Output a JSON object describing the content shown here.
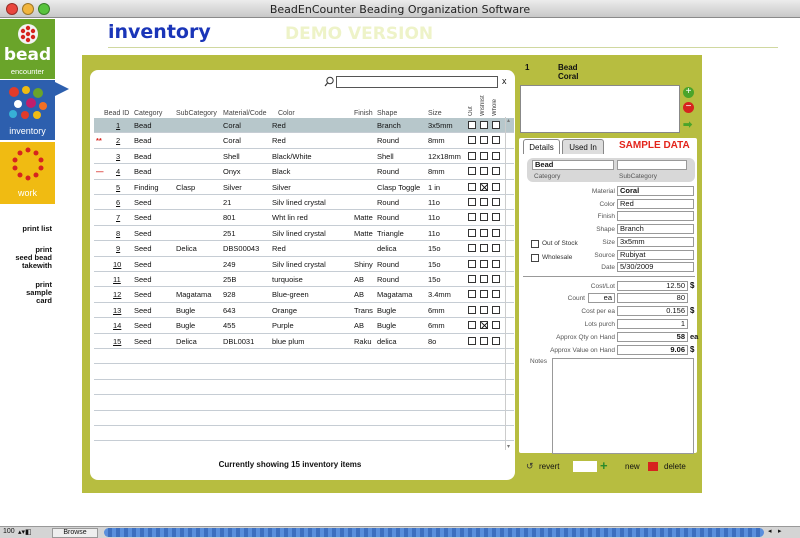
{
  "window": {
    "title": "BeadEnCounter Beading Organization Software"
  },
  "nav": {
    "logo_top": "bead",
    "logo_bottom": "encounter",
    "inventory_label": "inventory",
    "work_label": "work",
    "print_list": "print list",
    "print_takewith_1": "print",
    "print_takewith_2": "seed bead",
    "print_takewith_3": "takewith",
    "print_card_1": "print",
    "print_card_2": "sample",
    "print_card_3": "card"
  },
  "main": {
    "heading": "inventory",
    "demo_watermark": "DEMO VERSION",
    "search_close": "x"
  },
  "table": {
    "columns": {
      "id": "Bead ID",
      "category": "Category",
      "subcategory": "SubCategory",
      "material": "Material/Code",
      "color": "Color",
      "finish": "Finish",
      "shape": "Shape",
      "size": "Size",
      "c1": "Out",
      "c2": "Wishlist",
      "c3": "Whole"
    },
    "rows": [
      {
        "marker": "",
        "id": "1",
        "category": "Bead",
        "subcategory": "",
        "material": "Coral",
        "color": "Red",
        "finish": "",
        "shape": "Branch",
        "size": "3x5mm",
        "c": [
          false,
          false,
          false
        ]
      },
      {
        "marker": "**",
        "id": "2",
        "category": "Bead",
        "subcategory": "",
        "material": "Coral",
        "color": "Red",
        "finish": "",
        "shape": "Round",
        "size": "8mm",
        "c": [
          false,
          false,
          false
        ]
      },
      {
        "marker": "",
        "id": "3",
        "category": "Bead",
        "subcategory": "",
        "material": "Shell",
        "color": "Black/White",
        "finish": "",
        "shape": "Shell",
        "size": "12x18mm",
        "c": [
          false,
          false,
          false
        ]
      },
      {
        "marker": "—",
        "id": "4",
        "category": "Bead",
        "subcategory": "",
        "material": "Onyx",
        "color": "Black",
        "finish": "",
        "shape": "Round",
        "size": "8mm",
        "c": [
          false,
          false,
          false
        ]
      },
      {
        "marker": "",
        "id": "5",
        "category": "Finding",
        "subcategory": "Clasp",
        "material": "Silver",
        "color": "Silver",
        "finish": "",
        "shape": "Clasp Toggle",
        "size": "1 in",
        "c": [
          false,
          true,
          false
        ]
      },
      {
        "marker": "",
        "id": "6",
        "category": "Seed",
        "subcategory": "",
        "material": "21",
        "color": "Silv lined crystal",
        "finish": "",
        "shape": "Round",
        "size": "11o",
        "c": [
          false,
          false,
          false
        ]
      },
      {
        "marker": "",
        "id": "7",
        "category": "Seed",
        "subcategory": "",
        "material": "801",
        "color": "Wht lin red",
        "finish": "Matte",
        "shape": "Round",
        "size": "11o",
        "c": [
          false,
          false,
          false
        ]
      },
      {
        "marker": "",
        "id": "8",
        "category": "Seed",
        "subcategory": "",
        "material": "251",
        "color": "Silv lined crystal",
        "finish": "Matte",
        "shape": "Triangle",
        "size": "11o",
        "c": [
          false,
          false,
          false
        ]
      },
      {
        "marker": "",
        "id": "9",
        "category": "Seed",
        "subcategory": "Delica",
        "material": "DBS00043",
        "color": "Red",
        "finish": "",
        "shape": "delica",
        "size": "15o",
        "c": [
          false,
          false,
          false
        ]
      },
      {
        "marker": "",
        "id": "10",
        "category": "Seed",
        "subcategory": "",
        "material": "249",
        "color": "Silv lined crystal",
        "finish": "Shiny",
        "shape": "Round",
        "size": "15o",
        "c": [
          false,
          false,
          false
        ]
      },
      {
        "marker": "",
        "id": "11",
        "category": "Seed",
        "subcategory": "",
        "material": "25B",
        "color": "turquoise",
        "finish": "AB",
        "shape": "Round",
        "size": "15o",
        "c": [
          false,
          false,
          false
        ]
      },
      {
        "marker": "",
        "id": "12",
        "category": "Seed",
        "subcategory": "Magatama",
        "material": "928",
        "color": "Blue-green",
        "finish": "AB",
        "shape": "Magatama",
        "size": "3.4mm",
        "c": [
          false,
          false,
          false
        ]
      },
      {
        "marker": "",
        "id": "13",
        "category": "Seed",
        "subcategory": "Bugle",
        "material": "643",
        "color": "Orange",
        "finish": "Trans",
        "shape": "Bugle",
        "size": "6mm",
        "c": [
          false,
          false,
          false
        ]
      },
      {
        "marker": "",
        "id": "14",
        "category": "Seed",
        "subcategory": "Bugle",
        "material": "455",
        "color": "Purple",
        "finish": "AB",
        "shape": "Bugle",
        "size": "6mm",
        "c": [
          false,
          true,
          false
        ]
      },
      {
        "marker": "",
        "id": "15",
        "category": "Seed",
        "subcategory": "Delica",
        "material": "DBL0031",
        "color": "blue plum",
        "finish": "Raku",
        "shape": "delica",
        "size": "8o",
        "c": [
          false,
          false,
          false
        ]
      }
    ],
    "status": "Currently showing 15 inventory items"
  },
  "detail": {
    "record_no": "1",
    "title_1": "Bead",
    "title_2": "Coral",
    "tab_details": "Details",
    "tab_used_in": "Used In",
    "sample_data": "SAMPLE DATA",
    "category_value": "Bead",
    "subcategory_value": "",
    "category_label": "Category",
    "subcategory_label": "SubCategory",
    "labels": {
      "material": "Material",
      "color": "Color",
      "finish": "Finish",
      "shape": "Shape",
      "size": "Size",
      "source": "Source",
      "date": "Date",
      "out_of_stock": "Out of Stock",
      "wholesale": "Wholesale",
      "cost_lot": "Cost/Lot",
      "count": "Count",
      "cost_per_ea": "Cost per ea",
      "lots_purch": "Lots purch",
      "qty_on_hand": "Approx Qty on Hand",
      "value_on_hand": "Approx Value on Hand",
      "notes": "Notes"
    },
    "values": {
      "material": "Coral",
      "color": "Red",
      "finish": "",
      "shape": "Branch",
      "size": "3x5mm",
      "source": "Rubiyat",
      "date": "5/30/2009",
      "cost_lot": "12.50",
      "count_unit": "ea",
      "count": "80",
      "cost_per_ea": "0.156",
      "lots_purch": "1",
      "qty_on_hand": "58",
      "value_on_hand": "9.06"
    },
    "units": {
      "dollar": "$",
      "ea": "ea"
    },
    "revert": "revert",
    "new": "new",
    "delete": "delete"
  },
  "statusbar": {
    "zoom": "100",
    "mode": "Browse"
  },
  "colors": {
    "accent_green": "#b7bd40",
    "heading_blue": "#1a35b8",
    "nav_red": "#d6241e",
    "nav_blue": "#2d5fae",
    "nav_yellow": "#f0bb12",
    "sample_red": "#e3241b"
  }
}
